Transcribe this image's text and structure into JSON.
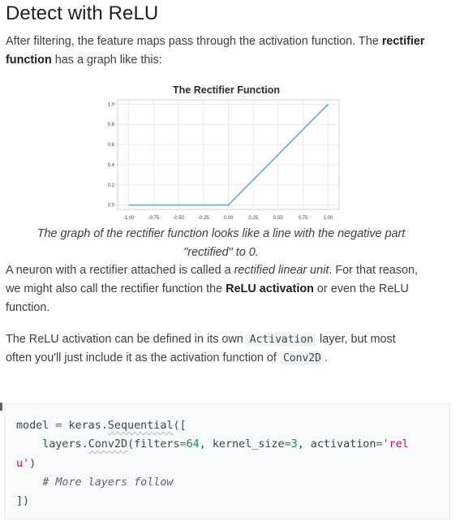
{
  "heading": "Detect with ReLU",
  "intro": {
    "part1": "After filtering, the feature maps pass through the activation function. The ",
    "bold": "rectifier function",
    "part2": " has a graph like this:"
  },
  "chart_data": {
    "type": "line",
    "title": "The Rectifier Function",
    "xlabel": "",
    "ylabel": "",
    "xlim": [
      -1.0,
      1.0
    ],
    "ylim": [
      0.0,
      1.0
    ],
    "x_ticks": [
      "-1.00",
      "-0.75",
      "-0.50",
      "-0.25",
      "0.00",
      "0.25",
      "0.50",
      "0.75",
      "1.00"
    ],
    "y_ticks": [
      "0.0",
      "0.2",
      "0.4",
      "0.6",
      "0.8",
      "1.0"
    ],
    "grid": true,
    "series": [
      {
        "x": [
          -1.0,
          0.0,
          1.0
        ],
        "y": [
          0.0,
          0.0,
          1.0
        ],
        "color": "#6aa5d6"
      }
    ]
  },
  "caption": {
    "line1": "The graph of the rectifier function looks like a line with the negative part",
    "line2": "\"rectified\" to 0."
  },
  "para2": {
    "t1": "A neuron with a rectifier attached is called a ",
    "i1": "rectified linear unit",
    "t2": ". For that reason,",
    "t3": "we might also call the rectifier function the ",
    "b1": "ReLU activation",
    "t4": " or even the ReLU",
    "t5": "function."
  },
  "para3": {
    "t1": "The ReLU activation can be defined in its own ",
    "code1": "Activation",
    "t2": " layer, but most",
    "t3": "often you'll just include it as the activation function of ",
    "code2": "Conv2D",
    "t4": "."
  },
  "code": {
    "l1_a": "model",
    "l1_b": " = ",
    "l1_c": "keras.",
    "l1_d": "Sequential",
    "l1_e": "([",
    "l2_a": "    layers.",
    "l2_b": "Conv2D",
    "l2_c": "(filters",
    "l2_d": "=",
    "l2_e": "64",
    "l2_f": ", kernel_size",
    "l2_g": "=",
    "l2_h": "3",
    "l2_i": ", activation",
    "l2_j": "=",
    "l2_k": "'rel",
    "l3_a": "u'",
    "l3_b": ")",
    "l4": "    # More layers follow",
    "l5": "])"
  }
}
